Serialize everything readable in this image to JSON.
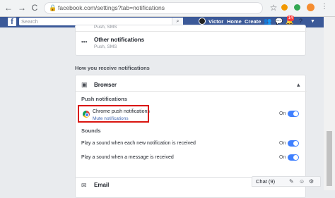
{
  "browser": {
    "url": "facebook.com/settings?tab=notifications",
    "lock": "🔒",
    "back": "←",
    "forward": "→",
    "reload": "C",
    "star": "☆"
  },
  "fb_header": {
    "logo": "f",
    "search_placeholder": "Search",
    "search_icon": "⌕",
    "user_name": "Victor",
    "home": "Home",
    "create": "Create",
    "notification_count": "14",
    "brand_color": "#3b5998"
  },
  "settings": {
    "top_cut_text": "Push, SMS",
    "other_notifications": {
      "title": "Other notifications",
      "subtitle": "Push, SMS",
      "icon": "•••"
    },
    "how_receive_heading": "How you receive notifications",
    "browser_section": {
      "title": "Browser",
      "icon": "▣",
      "collapse": "▴",
      "push_heading": "Push notifications",
      "chrome_title": "Chrome push notifications",
      "chrome_sub": "Mute notifications",
      "chrome_state": "On",
      "sounds_heading": "Sounds",
      "sound_new_text": "Play a sound when each new notification is received",
      "sound_new_state": "On",
      "sound_msg_text": "Play a sound when a message is received",
      "sound_msg_state": "On"
    },
    "email_section": {
      "title": "Email",
      "icon": "✉"
    }
  },
  "chat": {
    "label": "Chat (9)",
    "edit_icon": "✎",
    "people_icon": "☺",
    "gear_icon": "⚙"
  }
}
